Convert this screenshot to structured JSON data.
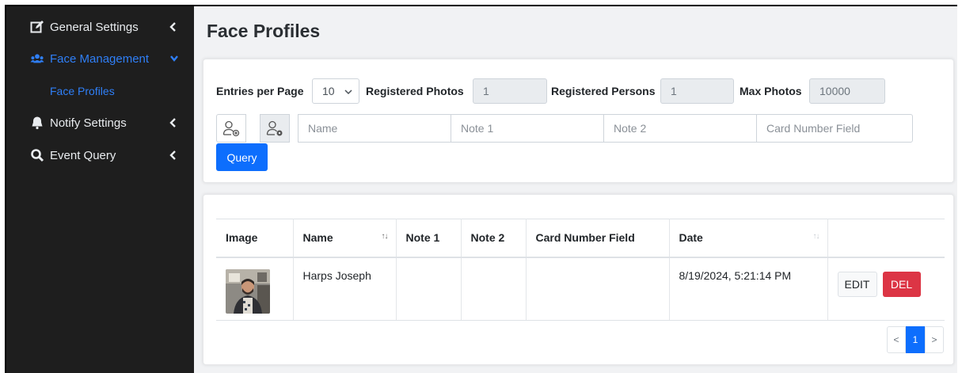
{
  "sidebar": {
    "items": [
      {
        "label": "General Settings",
        "icon": "edit-icon"
      },
      {
        "label": "Face Management",
        "icon": "users-icon"
      },
      {
        "label": "Notify Settings",
        "icon": "bell-icon"
      },
      {
        "label": "Event Query",
        "icon": "search-icon"
      }
    ],
    "sub_items": [
      {
        "label": "Face Profiles"
      }
    ]
  },
  "page": {
    "title": "Face Profiles"
  },
  "filters": {
    "entries_label": "Entries per Page",
    "entries_value": "10",
    "registered_photos_label": "Registered Photos",
    "registered_photos_value": "1",
    "registered_persons_label": "Registered Persons",
    "registered_persons_value": "1",
    "max_photos_label": "Max Photos",
    "max_photos_value": "10000",
    "name_placeholder": "Name",
    "note1_placeholder": "Note 1",
    "note2_placeholder": "Note 2",
    "card_placeholder": "Card Number Field",
    "query_label": "Query"
  },
  "table": {
    "headers": [
      "Image",
      "Name",
      "Note 1",
      "Note 2",
      "Card Number Field",
      "Date",
      ""
    ],
    "rows": [
      {
        "name": "Harps Joseph",
        "note1": "",
        "note2": "",
        "card": "",
        "date": "8/19/2024, 5:21:14 PM",
        "edit_label": "EDIT",
        "del_label": "DEL"
      }
    ]
  },
  "pagination": {
    "prev": "<",
    "current": "1",
    "next": ">"
  },
  "colors": {
    "sidebar_bg": "#1e1e1e",
    "accent": "#0d6efd",
    "danger": "#dc3545",
    "active_nav": "#2f7ff7"
  }
}
